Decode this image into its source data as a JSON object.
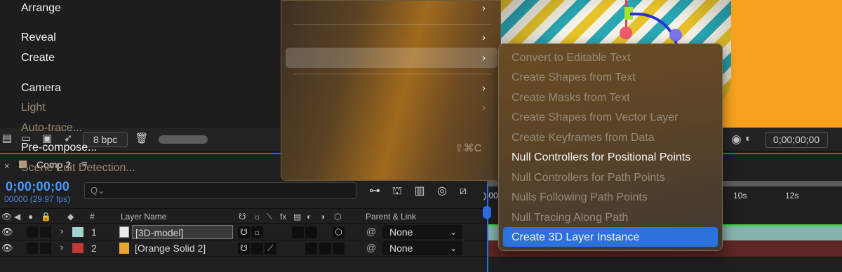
{
  "footer": {
    "bpc": "8 bpc",
    "viewer_timecode": "0;00;00;00"
  },
  "composition_tab": {
    "close": "×",
    "label": "Comp 2",
    "menu": "≡"
  },
  "timeline": {
    "current_time": "0;00;00;00",
    "current_frames": "00000 (29.97 fps)",
    "search_placeholder": "Q⌄",
    "ruler_ticks": [
      "):00",
      "10s",
      "12s"
    ],
    "columns": {
      "hash": "#",
      "layer_name": "Layer Name",
      "fx": "fx",
      "parent_link": "Parent & Link"
    },
    "layers": [
      {
        "num": "1",
        "name": "[3D-model]",
        "label_color": "#a3d4cf",
        "parent": "None"
      },
      {
        "num": "2",
        "name": "[Orange Solid 2]",
        "label_color": "#c13a35",
        "parent": "None"
      }
    ]
  },
  "main_menu": {
    "items": [
      {
        "label": "Arrange",
        "enabled": true,
        "submenu": true
      },
      {
        "label": "Reveal",
        "enabled": true,
        "submenu": true
      },
      {
        "label": "Create",
        "enabled": true,
        "submenu": true,
        "highlighted": true
      },
      {
        "label": "Camera",
        "enabled": true,
        "submenu": true
      },
      {
        "label": "Light",
        "enabled": false,
        "submenu": true
      },
      {
        "label": "Auto-trace...",
        "enabled": false
      },
      {
        "label": "Pre-compose...",
        "enabled": true,
        "shortcut": "⇧⌘C"
      },
      {
        "label": "Scene Edit Detection...",
        "enabled": false
      }
    ],
    "arrow": "›"
  },
  "create_submenu": {
    "items": [
      {
        "label": "Convert to Editable Text",
        "enabled": false
      },
      {
        "label": "Create Shapes from Text",
        "enabled": false
      },
      {
        "label": "Create Masks from Text",
        "enabled": false
      },
      {
        "label": "Create Shapes from Vector Layer",
        "enabled": false
      },
      {
        "label": "Create Keyframes from Data",
        "enabled": false
      },
      {
        "label": "Null Controllers for Positional Points",
        "enabled": true
      },
      {
        "label": "Null Controllers for Path Points",
        "enabled": false
      },
      {
        "label": "Nulls Following Path Points",
        "enabled": false
      },
      {
        "label": "Null Tracing Along Path",
        "enabled": false
      },
      {
        "label": "Create 3D Layer Instance",
        "enabled": true,
        "highlighted": true
      }
    ]
  },
  "colors": {
    "accent_blue": "#2c72dc",
    "timecode_blue": "#4a9bff"
  },
  "icons": [
    "folder-icon",
    "trash-icon",
    "eye-icon",
    "audio-icon",
    "lock-icon",
    "label-icon",
    "cube-icon",
    "pickwhip-icon",
    "camera-icon"
  ]
}
